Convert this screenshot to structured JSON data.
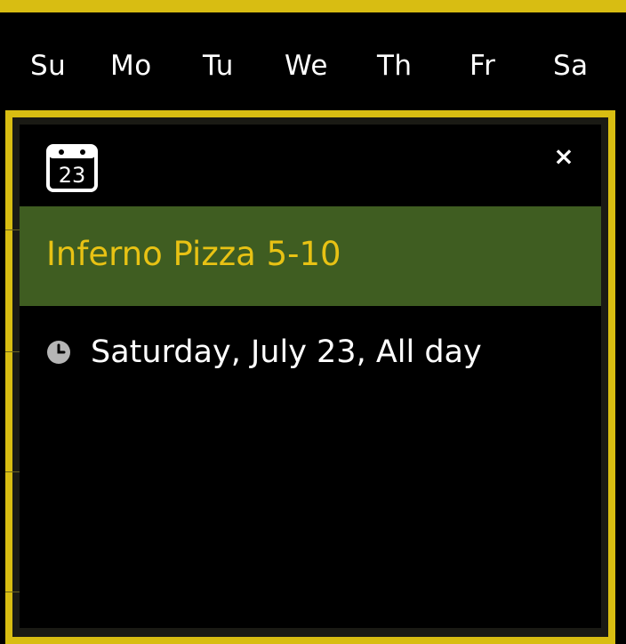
{
  "calendar": {
    "weekdays": [
      "Su",
      "Mo",
      "Tu",
      "We",
      "Th",
      "Fr",
      "Sa"
    ]
  },
  "popup": {
    "calendar_icon": {
      "name": "calendar-icon",
      "day": "23"
    },
    "close_label": "×",
    "event": {
      "title": "Inferno Pizza 5-10",
      "when": "Saturday, July 23, All day"
    }
  },
  "colors": {
    "accent_yellow": "#d8bd12",
    "event_green": "#3f5d21",
    "event_title": "#e8c214",
    "background": "#000000"
  }
}
